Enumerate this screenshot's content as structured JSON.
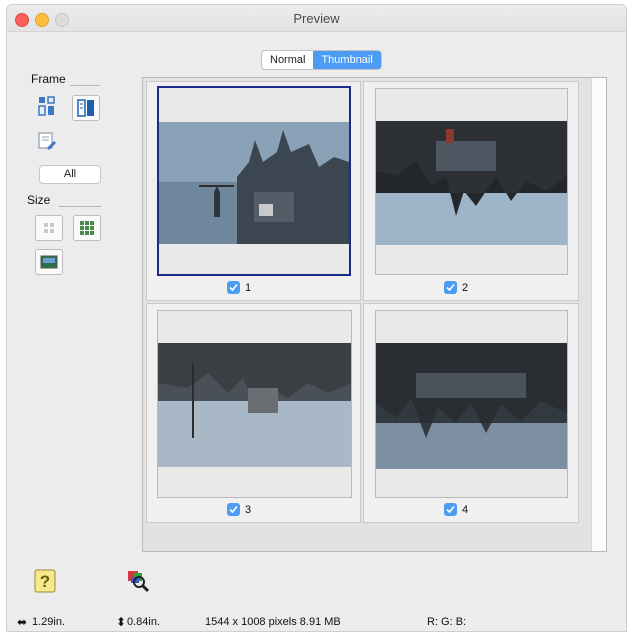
{
  "window": {
    "title": "Preview"
  },
  "view_toggle": {
    "normal_label": "Normal",
    "thumbnail_label": "Thumbnail",
    "active": "Thumbnail"
  },
  "frame_section": {
    "label": "Frame",
    "all_button": "All"
  },
  "size_section": {
    "label": "Size"
  },
  "thumbnails": [
    {
      "number": "1",
      "checked": true,
      "selected": true
    },
    {
      "number": "2",
      "checked": true,
      "selected": false
    },
    {
      "number": "3",
      "checked": true,
      "selected": false
    },
    {
      "number": "4",
      "checked": true,
      "selected": false
    }
  ],
  "status_bar": {
    "width": "1.29in.",
    "height": "0.84in.",
    "size_info": "1544 x 1008 pixels 8.91 MB",
    "rgb": "R: G: B:"
  },
  "colors": {
    "accent": "#4c9cf3",
    "selection_border": "#1d2a86"
  },
  "icons": {
    "help": "question-mark-icon",
    "color_picker": "magnifier-color-icon",
    "width_arrow": "horizontal-arrows-icon",
    "height_arrow": "vertical-arrows-icon"
  }
}
